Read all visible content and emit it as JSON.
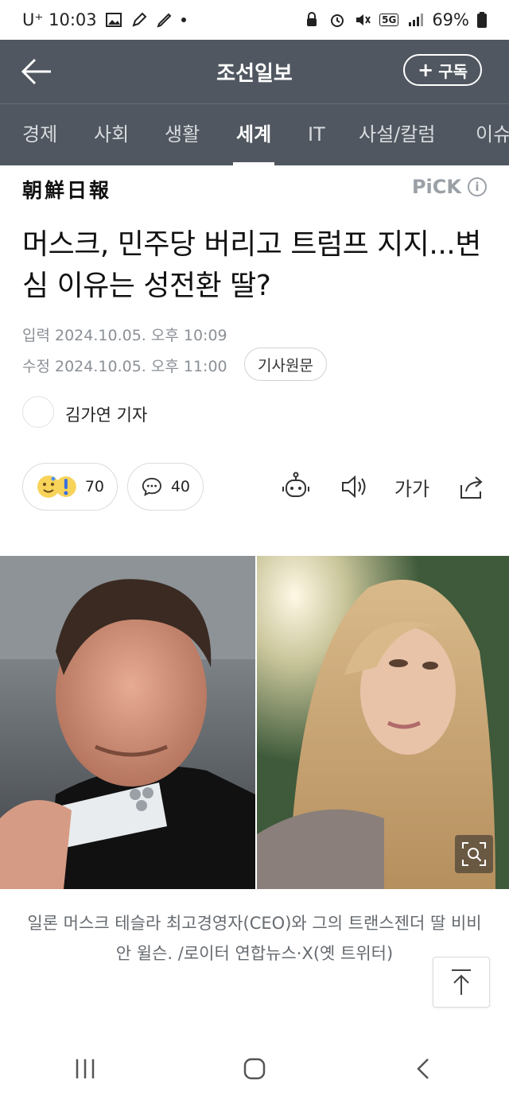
{
  "statusbar": {
    "carrier_time": "U⁺ 10:03",
    "network": "5G",
    "battery": "69%"
  },
  "appbar": {
    "title": "조선일보",
    "subscribe_label": "구독"
  },
  "tabs": [
    "경제",
    "사회",
    "생활",
    "세계",
    "IT",
    "사설/칼럼",
    "이슈"
  ],
  "active_tab": "세계",
  "article": {
    "press_name": "朝鮮日報",
    "pick_label": "PiCK",
    "headline": "머스크, 민주당 버리고 트럼프 지지...변심 이유는 성전환 딸?",
    "published": "입력 2024.10.05. 오후 10:09",
    "modified": "수정 2024.10.05. 오후 11:00",
    "original_label": "기사원문",
    "reporter": "김가연 기자",
    "reaction_count": "70",
    "comment_count": "40",
    "font_size_label": "가가",
    "caption": "일론 머스크 테슬라 최고경영자(CEO)와 그의 트랜스젠더 딸 비비안 윌슨. /로이터 연합뉴스·X(옛 트위터)"
  },
  "colors": {
    "appbar": "#505760",
    "meta_text": "#8b9096",
    "accent_white": "#ffffff"
  }
}
